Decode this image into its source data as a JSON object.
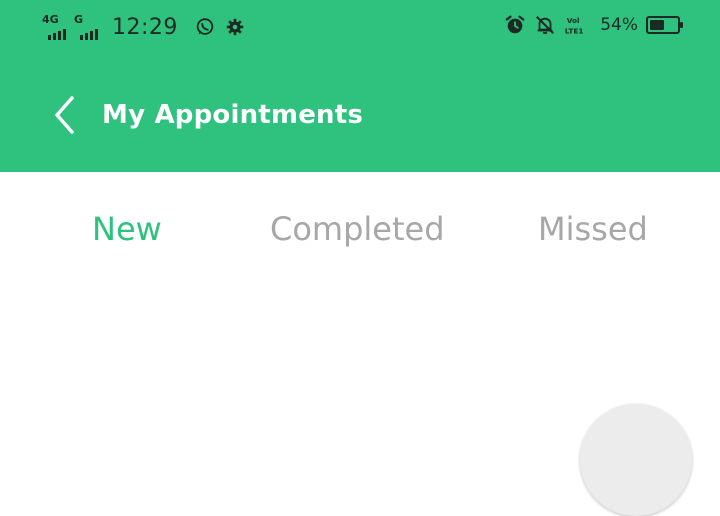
{
  "colors": {
    "primary": "#2ec27e",
    "tab_active": "#2ec27e",
    "tab_inactive": "#a7a7a7",
    "status_icon": "#1c2a24"
  },
  "status_bar": {
    "network1_label": "4G",
    "network2_label": "G",
    "time": "12:29",
    "battery_percent": "54%",
    "battery_level": 0.54,
    "icons": [
      "whatsapp-icon",
      "settings-gear-icon",
      "alarm-icon",
      "notifications-off-icon",
      "volte-icon",
      "battery-icon"
    ]
  },
  "toolbar": {
    "title": "My Appointments",
    "back_icon": "back-arrow-icon"
  },
  "tabs": [
    {
      "label": "New",
      "active": true
    },
    {
      "label": "Completed",
      "active": false
    },
    {
      "label": "Missed",
      "active": false
    }
  ]
}
